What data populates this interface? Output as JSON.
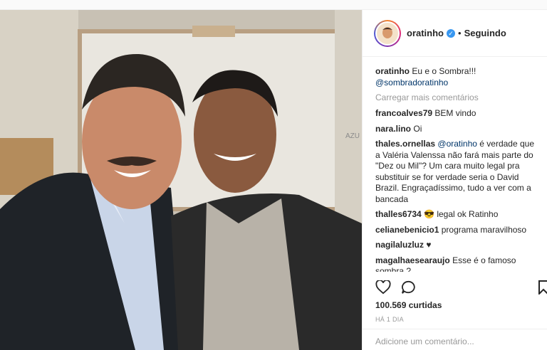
{
  "post": {
    "username": "oratinho",
    "dot": "•",
    "follow_status": "Seguindo",
    "verified_mark": "✓",
    "caption_user": "oratinho",
    "caption_text": "Eu e o Sombra!!!",
    "caption_mention": "@sombradoratinho",
    "load_more": "Carregar mais comentários",
    "likes": "100.569 curtidas",
    "time": "HÁ 1 DIA",
    "add_comment_placeholder": "Adicione um comentário..."
  },
  "comments": [
    {
      "user": "francoalves79",
      "text": "BEM vindo"
    },
    {
      "user": "nara.lino",
      "text": "Oi"
    },
    {
      "user": "thales.ornellas",
      "mention": "@oratinho",
      "text": "é verdade que a Valéria Valenssa não fará mais parte do \"Dez ou Mil\"? Um cara muito legal pra substituir se for verdade seria o David Brazil. Engraçadíssimo, tudo a ver com a bancada"
    },
    {
      "user": "thalles6734",
      "text": "😎 legal ok Ratinho"
    },
    {
      "user": "celianebenicio1",
      "text": "programa maravilhoso"
    },
    {
      "user": "nagilaluzluz",
      "text": "♥"
    },
    {
      "user": "magalhaesearaujo",
      "text": "Esse é o famoso sombra ?"
    }
  ],
  "icons": {
    "verified": "verified-badge-icon",
    "like": "heart-icon",
    "comment": "comment-icon",
    "save": "bookmark-icon"
  },
  "colors": {
    "link": "#003569",
    "verified": "#3897f0",
    "muted": "#999999"
  }
}
